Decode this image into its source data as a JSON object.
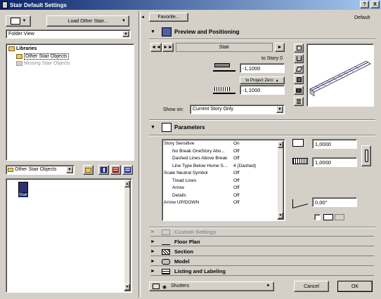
{
  "window": {
    "title": "Stair Default Settings",
    "help_label": "?",
    "close_label": "X"
  },
  "left": {
    "load_button": "Load Other Stair...",
    "view_select": "Folder View",
    "tree": [
      {
        "label": "Libraries",
        "selected": false,
        "disabled": false
      },
      {
        "label": "Other Stair Objects",
        "selected": true,
        "disabled": false
      },
      {
        "label": "Missing Stair Objects",
        "selected": false,
        "disabled": true
      }
    ],
    "folder_select": "Other Stair Objects",
    "object_label": "Stair"
  },
  "right": {
    "favorites_button": "Favorite...",
    "default_label": "Default",
    "preview": {
      "title": "Preview and Positioning",
      "name_field": "Stair",
      "to_story_label": "to Story 0",
      "top_value": "-1,1000",
      "to_project_zero_label": "to Project Zero",
      "bottom_value": "-1,1000",
      "show_on_label": "Show on:",
      "show_on_value": "Current Story Only"
    },
    "parameters": {
      "title": "Parameters",
      "rows": [
        {
          "name": "Story Sensitive",
          "value": "On",
          "indent": false
        },
        {
          "name": "No Break OneStory Abo...",
          "value": "Off",
          "indent": true
        },
        {
          "name": "Dashed Lines Above Break",
          "value": "Off",
          "indent": true
        },
        {
          "name": "Line Type Below Home S...",
          "value": "4 (Dashed)",
          "indent": true
        },
        {
          "name": "Scale Neutral Symbol",
          "value": "Off",
          "indent": false
        },
        {
          "name": "Tread Lines",
          "value": "Off",
          "indent": true
        },
        {
          "name": "Arrow",
          "value": "Off",
          "indent": true
        },
        {
          "name": "Details",
          "value": "Off",
          "indent": true
        },
        {
          "name": "Arrow UP/DOWN",
          "value": "Off",
          "indent": false
        }
      ],
      "width_value": "1,0000",
      "depth_value": "1,0000",
      "angle_value": "0,00°"
    },
    "sections": [
      {
        "label": "Custom Settings",
        "disabled": true
      },
      {
        "label": "Floor Plan",
        "disabled": false
      },
      {
        "label": "Section",
        "disabled": false
      },
      {
        "label": "Model",
        "disabled": false
      },
      {
        "label": "Listing and Labeling",
        "disabled": false
      }
    ],
    "layer_select": "Shutters",
    "cancel_button": "Cancel",
    "ok_button": "OK"
  }
}
